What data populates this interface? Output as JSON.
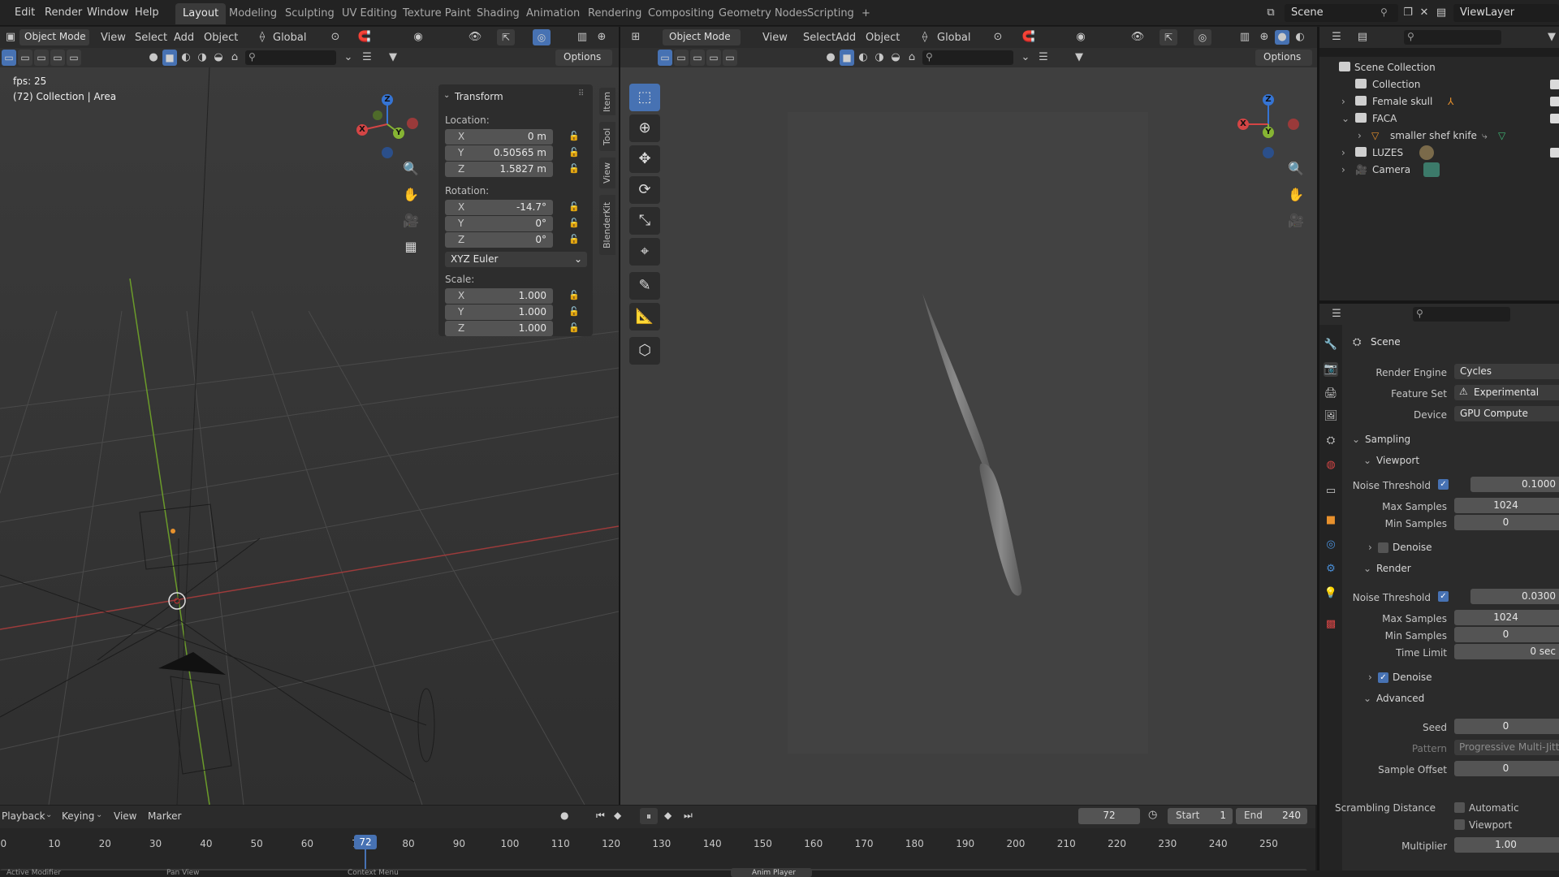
{
  "topbar": {
    "menus": [
      "Edit",
      "Render",
      "Window",
      "Help"
    ],
    "workspaces": [
      "Layout",
      "Modeling",
      "Sculpting",
      "UV Editing",
      "Texture Paint",
      "Shading",
      "Animation",
      "Rendering",
      "Compositing",
      "Geometry Nodes",
      "Scripting",
      "+"
    ],
    "active_workspace": "Layout",
    "scene_name": "Scene",
    "view_layer": "ViewLayer"
  },
  "left_viewport": {
    "mode": "Object Mode",
    "menus": [
      "View",
      "Select",
      "Add",
      "Object"
    ],
    "orientation": "Global",
    "options_label": "Options",
    "overlay_fps": "fps: 25",
    "overlay_info": "(72) Collection | Area"
  },
  "transform_panel": {
    "title": "Transform",
    "location_label": "Location:",
    "location": [
      {
        "axis": "X",
        "value": "0 m"
      },
      {
        "axis": "Y",
        "value": "0.50565 m"
      },
      {
        "axis": "Z",
        "value": "1.5827 m"
      }
    ],
    "rotation_label": "Rotation:",
    "rotation": [
      {
        "axis": "X",
        "value": "-14.7°"
      },
      {
        "axis": "Y",
        "value": "0°"
      },
      {
        "axis": "Z",
        "value": "0°"
      }
    ],
    "rotation_mode": "XYZ Euler",
    "scale_label": "Scale:",
    "scale": [
      {
        "axis": "X",
        "value": "1.000"
      },
      {
        "axis": "Y",
        "value": "1.000"
      },
      {
        "axis": "Z",
        "value": "1.000"
      }
    ]
  },
  "sidebar_tabs": [
    "Item",
    "Tool",
    "View",
    "BlenderKit"
  ],
  "right_viewport": {
    "mode": "Object Mode",
    "menus": [
      "View",
      "Select",
      "Add",
      "Object"
    ],
    "orientation": "Global",
    "options_label": "Options"
  },
  "gizmo": {
    "x": "X",
    "y": "Y",
    "z": "Z"
  },
  "outliner": {
    "root": "Scene Collection",
    "items": [
      {
        "name": "Collection",
        "level": 1,
        "expander": ""
      },
      {
        "name": "Female skull",
        "level": 1,
        "expander": "›"
      },
      {
        "name": "FACA",
        "level": 1,
        "expander": "⌄"
      },
      {
        "name": "smaller shef knife",
        "level": 2,
        "expander": "›"
      },
      {
        "name": "LUZES",
        "level": 1,
        "expander": "›"
      },
      {
        "name": "Camera",
        "level": 1,
        "expander": "›"
      }
    ]
  },
  "properties": {
    "context": "Scene",
    "render_engine_label": "Render Engine",
    "render_engine": "Cycles",
    "feature_set_label": "Feature Set",
    "feature_set": "Experimental",
    "device_label": "Device",
    "device": "GPU Compute",
    "sampling": "Sampling",
    "viewport": "Viewport",
    "noise_threshold_label": "Noise Threshold",
    "viewport_noise": "0.1000",
    "max_samples_label": "Max Samples",
    "viewport_max": "1024",
    "min_samples_label": "Min Samples",
    "viewport_min": "0",
    "denoise_label": "Denoise",
    "render": "Render",
    "render_noise": "0.0300",
    "render_max": "1024",
    "render_min": "0",
    "time_limit_label": "Time Limit",
    "time_limit": "0 sec",
    "advanced": "Advanced",
    "seed_label": "Seed",
    "seed": "0",
    "pattern_label": "Pattern",
    "pattern": "Progressive Multi-Jitter",
    "sample_offset_label": "Sample Offset",
    "sample_offset": "0",
    "scrambling_label": "Scrambling Distance",
    "automatic_label": "Automatic",
    "viewport_label": "Viewport",
    "multiplier_label": "Multiplier",
    "multiplier": "1.00"
  },
  "timeline": {
    "menus": [
      "Playback",
      "Keying",
      "View",
      "Marker"
    ],
    "current_frame": "72",
    "start_label": "Start",
    "start": "1",
    "end_label": "End",
    "end": "240",
    "ticks": [
      "0",
      "10",
      "20",
      "30",
      "40",
      "50",
      "60",
      "70",
      "80",
      "90",
      "100",
      "110",
      "120",
      "130",
      "140",
      "150",
      "160",
      "170",
      "180",
      "190",
      "200",
      "210",
      "220",
      "230",
      "240",
      "250"
    ]
  },
  "statusbar": {
    "items": [
      "Active Modifier",
      "Pan View",
      "Context Menu",
      "Anim Player"
    ]
  }
}
